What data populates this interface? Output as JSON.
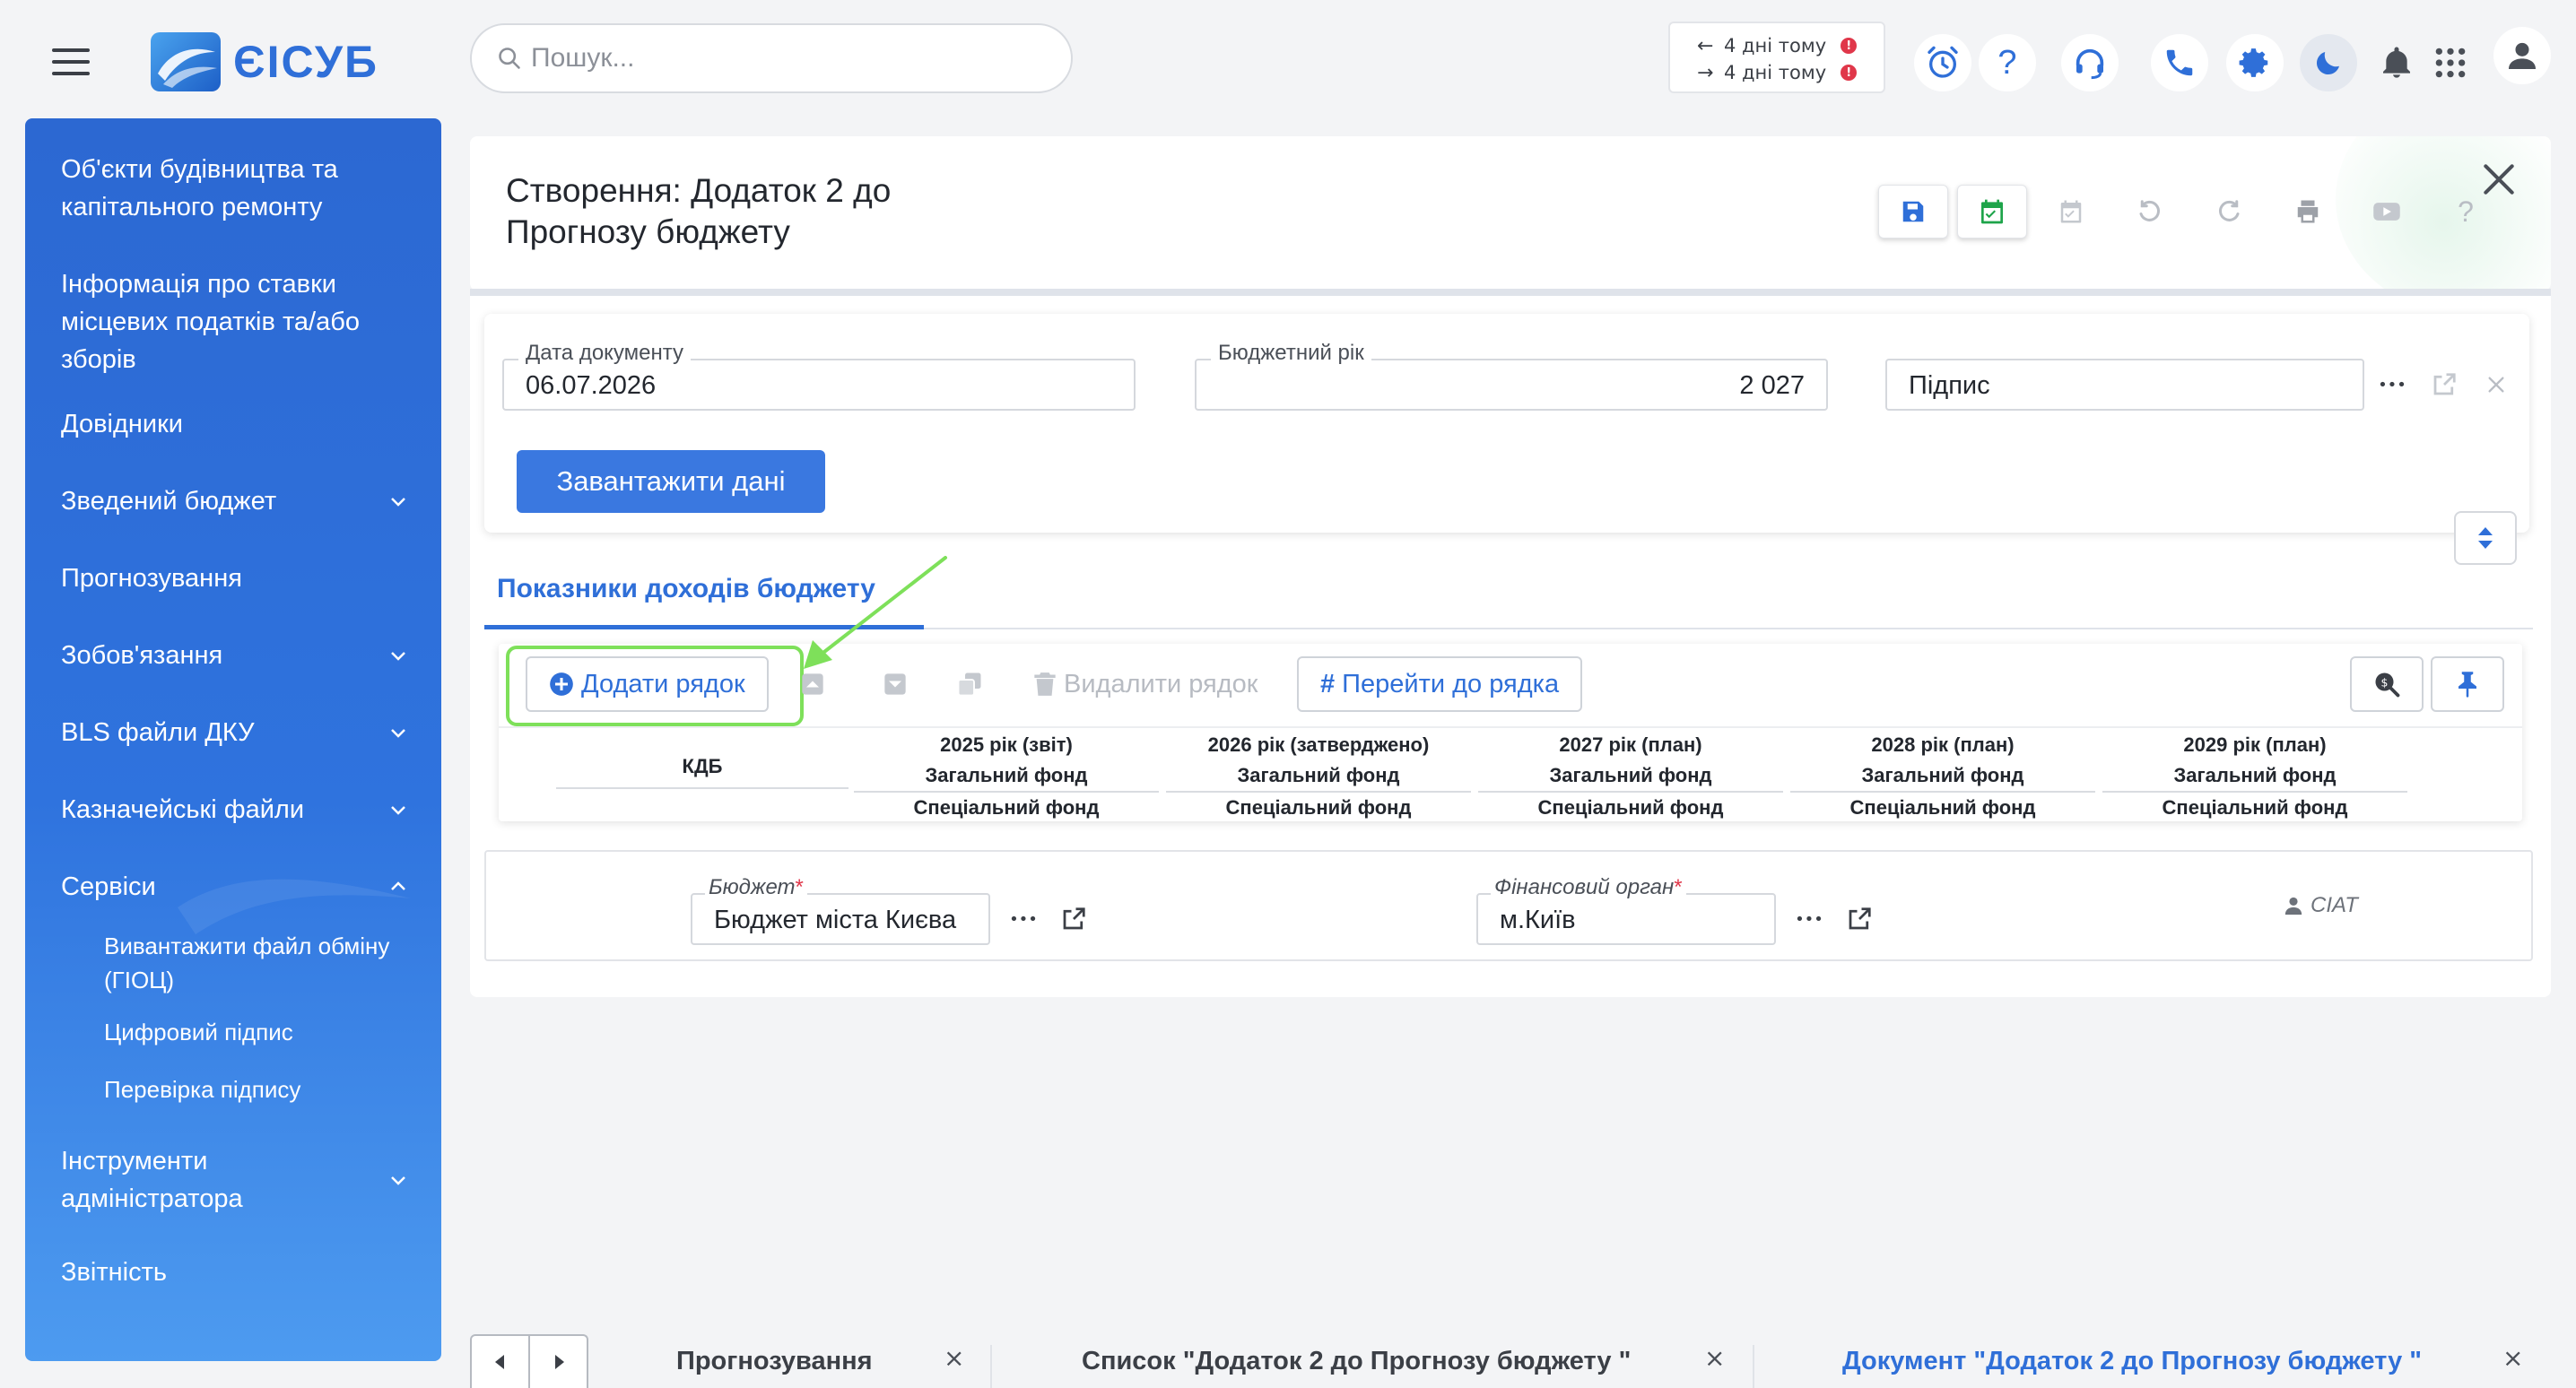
{
  "app": {
    "logo_text": "ЄІСУБ"
  },
  "search": {
    "placeholder": "Пошук..."
  },
  "notifications": [
    {
      "direction": "←",
      "text": "4 дні тому",
      "badge": "!"
    },
    {
      "direction": "→",
      "text": "4 дні тому",
      "badge": "!"
    }
  ],
  "topbar_icons": [
    "alarm-icon",
    "help-icon",
    "support-headset-icon",
    "phone-icon",
    "settings-icon",
    "dark-mode-icon",
    "bell-icon",
    "apps-grid-icon",
    "user-icon"
  ],
  "sidebar": {
    "items": [
      {
        "label": "Об'єкти будівництва та капітального ремонту",
        "expandable": false
      },
      {
        "label": "Інформація про ставки місцевих податків та/або зборів",
        "expandable": false
      },
      {
        "label": "Довідники",
        "expandable": false
      },
      {
        "label": "Зведений бюджет",
        "expandable": true
      },
      {
        "label": "Прогнозування",
        "expandable": false
      },
      {
        "label": "Зобов'язання",
        "expandable": true
      },
      {
        "label": "BLS файли ДКУ",
        "expandable": true
      },
      {
        "label": "Казначейські файли",
        "expandable": true
      },
      {
        "label": "Сервіси",
        "expandable": true,
        "expanded": true
      },
      {
        "label": "Інструменти адміністратора",
        "expandable": true
      },
      {
        "label": "Звітність",
        "expandable": false
      }
    ],
    "sub_items": [
      "Вивантажити файл обміну (ГІОЦ)",
      "Цифровий підпис",
      "Перевірка підпису"
    ]
  },
  "document": {
    "title": "Створення: Додаток 2 до Прогнозу бюджету",
    "tools": [
      "save-icon",
      "save-and-close-icon",
      "approve-icon",
      "undo-icon",
      "redo-icon",
      "print-icon",
      "video-icon",
      "help-icon"
    ]
  },
  "form": {
    "date_label": "Дата документу",
    "date_value": "06.07.2026",
    "year_label": "Бюджетний рік",
    "year_value": "2 027",
    "signature_value": "Підпис",
    "load_button": "Завантажити дані",
    "more": "•••"
  },
  "tabs": [
    {
      "label": "Показники доходів бюджету",
      "active": true
    }
  ],
  "grid": {
    "toolbar": {
      "add_row": "Додати рядок",
      "delete_row": "Видалити рядок",
      "goto_row": "Перейти до рядка"
    },
    "columns": [
      {
        "title": "2025 рік (звіт)",
        "general": "Загальний фонд",
        "special": "Спеціальний фонд"
      },
      {
        "title": "2026 рік (затверджено)",
        "general": "Загальний фонд",
        "special": "Спеціальний фонд"
      },
      {
        "title": "2027 рік (план)",
        "general": "Загальний фонд",
        "special": "Спеціальний фонд"
      },
      {
        "title": "2028 рік (план)",
        "general": "Загальний фонд",
        "special": "Спеціальний фонд"
      },
      {
        "title": "2029 рік (план)",
        "general": "Загальний фонд",
        "special": "Спеціальний фонд"
      }
    ],
    "first_column": "КДБ"
  },
  "footer": {
    "budget_label": "Бюджет",
    "budget_value": "Бюджет міста Києва",
    "fin_label": "Фінансовий орган",
    "fin_value": "м.Київ",
    "required_mark": "*",
    "user": "CIAT"
  },
  "bottom_tabs": [
    {
      "label": "Прогнозування",
      "active": false
    },
    {
      "label": "Список \"Додаток 2 до Прогнозу бюджету \"",
      "active": false
    },
    {
      "label": "Документ \"Додаток 2 до Прогнозу бюджету \"",
      "active": true
    }
  ],
  "colors": {
    "accent": "#2f6fd8",
    "primary_button": "#3a78e0",
    "highlight": "#7ee05a",
    "danger": "#e0374a"
  }
}
